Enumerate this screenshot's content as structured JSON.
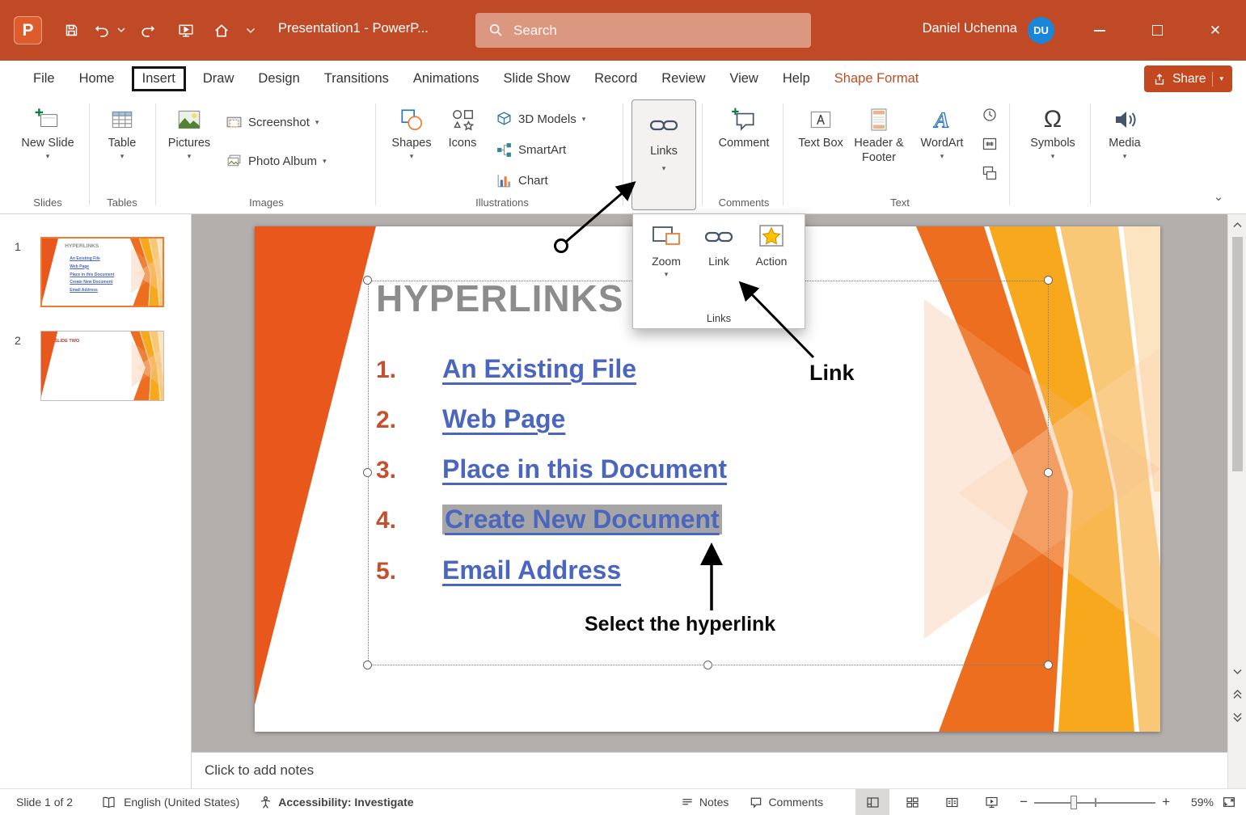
{
  "titlebar": {
    "title": "Presentation1  -  PowerP...",
    "search_placeholder": "Search",
    "user_name": "Daniel Uchenna",
    "user_initials": "DU"
  },
  "menubar": {
    "tabs": {
      "file": "File",
      "home": "Home",
      "insert": "Insert",
      "draw": "Draw",
      "design": "Design",
      "transitions": "Transitions",
      "animations": "Animations",
      "slide_show": "Slide Show",
      "record": "Record",
      "review": "Review",
      "view": "View",
      "help": "Help",
      "shape_format": "Shape Format"
    },
    "share_label": "Share"
  },
  "ribbon": {
    "buttons": {
      "new_slide": "New Slide",
      "table": "Table",
      "pictures": "Pictures",
      "screenshot": "Screenshot",
      "photo_album": "Photo Album",
      "shapes": "Shapes",
      "icons_btn": "Icons",
      "models_3d": "3D Models",
      "smartart": "SmartArt",
      "chart": "Chart",
      "links": "Links",
      "comment": "Comment",
      "text_box": "Text Box",
      "header_footer": "Header & Footer",
      "wordart": "WordArt",
      "symbols": "Symbols",
      "media": "Media"
    },
    "group_labels": {
      "slides": "Slides",
      "tables": "Tables",
      "images": "Images",
      "illustrations": "Illustrations",
      "comments": "Comments",
      "text": "Text"
    }
  },
  "links_dropdown": {
    "zoom": "Zoom",
    "link": "Link",
    "action": "Action",
    "group_label": "Links"
  },
  "annotations": {
    "link_callout": "Link",
    "select_hyperlink_callout": "Select the hyperlink"
  },
  "slide": {
    "title": "HYPERLINKS",
    "items": [
      {
        "num": "1.",
        "text": "An Existing File"
      },
      {
        "num": "2.",
        "text": "Web Page"
      },
      {
        "num": "3.",
        "text": "Place in this Document"
      },
      {
        "num": "4.",
        "text": "Create New Document"
      },
      {
        "num": "5.",
        "text": "Email Address"
      }
    ]
  },
  "thumbnails": {
    "slide1_number": "1",
    "slide2_number": "2",
    "slide2_title": "SLIDE TWO"
  },
  "notes": {
    "placeholder": "Click to add notes"
  },
  "statusbar": {
    "slide_indicator": "Slide 1 of 2",
    "language": "English (United States)",
    "accessibility": "Accessibility: Investigate",
    "notes_label": "Notes",
    "comments_label": "Comments",
    "zoom_level": "59%"
  },
  "icons": {
    "logo_p": "P",
    "dropdown_arrow": "▾",
    "collapse_ribbon": "⌄",
    "omega": "Ω",
    "close": "✕",
    "plus": "+",
    "minus": "−"
  }
}
